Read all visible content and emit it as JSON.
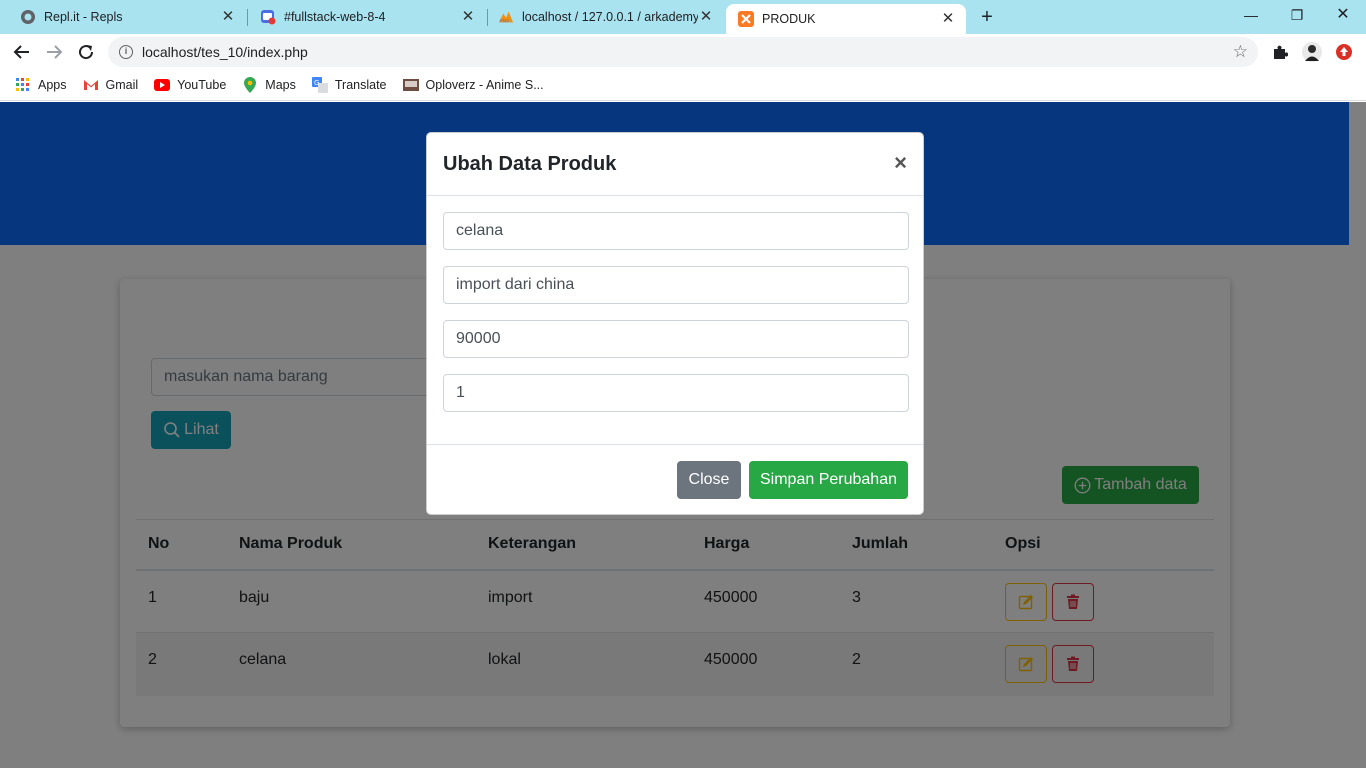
{
  "browser": {
    "tabs": [
      {
        "title": "Repl.it - Repls",
        "icon": "replit-icon",
        "active": false
      },
      {
        "title": "#fullstack-web-8-4",
        "icon": "chat-icon",
        "active": false
      },
      {
        "title": "localhost / 127.0.0.1 / arkademy",
        "icon": "phpmyadmin-icon",
        "active": false
      },
      {
        "title": "PRODUK",
        "icon": "xampp-icon",
        "active": true
      }
    ],
    "url": "localhost/tes_10/index.php",
    "bookmarks": [
      {
        "label": "Apps",
        "icon": "apps-grid-icon"
      },
      {
        "label": "Gmail",
        "icon": "gmail-icon"
      },
      {
        "label": "YouTube",
        "icon": "youtube-icon"
      },
      {
        "label": "Maps",
        "icon": "maps-pin-icon"
      },
      {
        "label": "Translate",
        "icon": "translate-icon"
      },
      {
        "label": "Oploverz - Anime S...",
        "icon": "oploverz-icon"
      }
    ]
  },
  "page": {
    "search": {
      "placeholder": "masukan nama barang"
    },
    "lihat_label": "Lihat",
    "tambah_label": "Tambah data",
    "table": {
      "headers": [
        "No",
        "Nama Produk",
        "Keterangan",
        "Harga",
        "Jumlah",
        "Opsi"
      ],
      "rows": [
        {
          "no": "1",
          "nama": "baju",
          "keterangan": "import",
          "harga": "450000",
          "jumlah": "3"
        },
        {
          "no": "2",
          "nama": "celana",
          "keterangan": "lokal",
          "harga": "450000",
          "jumlah": "2"
        }
      ]
    }
  },
  "modal": {
    "title": "Ubah Data Produk",
    "close_symbol": "×",
    "fields": [
      {
        "value": "celana"
      },
      {
        "value": "import dari china"
      },
      {
        "value": "90000"
      },
      {
        "value": "1"
      }
    ],
    "close_label": "Close",
    "save_label": "Simpan Perubahan"
  },
  "colors": {
    "hero": "#0d6efd",
    "info": "#17a2b8",
    "success": "#28a745",
    "secondary": "#6c757d",
    "warning": "#ffc107",
    "danger": "#dc3545"
  }
}
